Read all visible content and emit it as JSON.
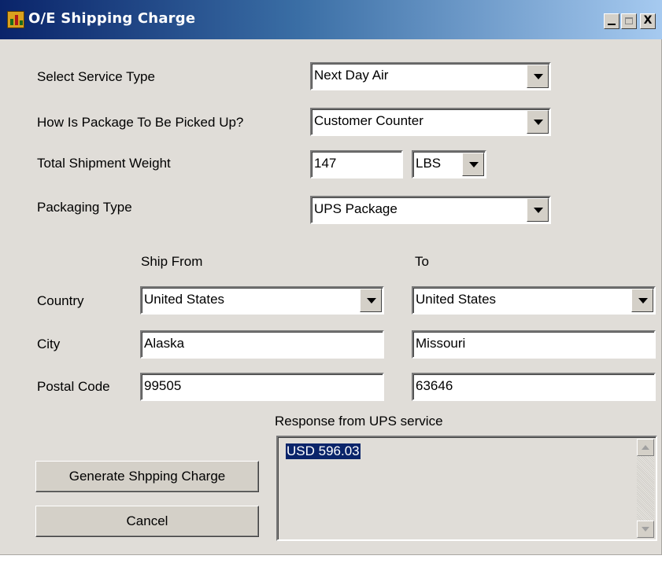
{
  "window": {
    "title": "O/E Shipping Charge",
    "controls": {
      "minimize": "_",
      "close": "X"
    }
  },
  "form": {
    "service_type": {
      "label": "Select Service Type",
      "value": "Next Day Air"
    },
    "pickup": {
      "label": "How Is Package To Be Picked Up?",
      "value": "Customer Counter"
    },
    "weight": {
      "label": "Total Shipment Weight",
      "value": "147",
      "unit": "LBS"
    },
    "packaging": {
      "label": "Packaging Type",
      "value": "UPS Package"
    }
  },
  "address": {
    "from_header": "Ship From",
    "to_header": "To",
    "country_label": "Country",
    "city_label": "City",
    "postal_label": "Postal Code",
    "from": {
      "country": "United States",
      "city": "Alaska",
      "postal": "99505"
    },
    "to": {
      "country": "United States",
      "city": "Missouri",
      "postal": "63646"
    }
  },
  "response": {
    "label": "Response from UPS service",
    "value": "USD 596.03"
  },
  "buttons": {
    "generate": "Generate Shpping Charge",
    "cancel": "Cancel"
  }
}
